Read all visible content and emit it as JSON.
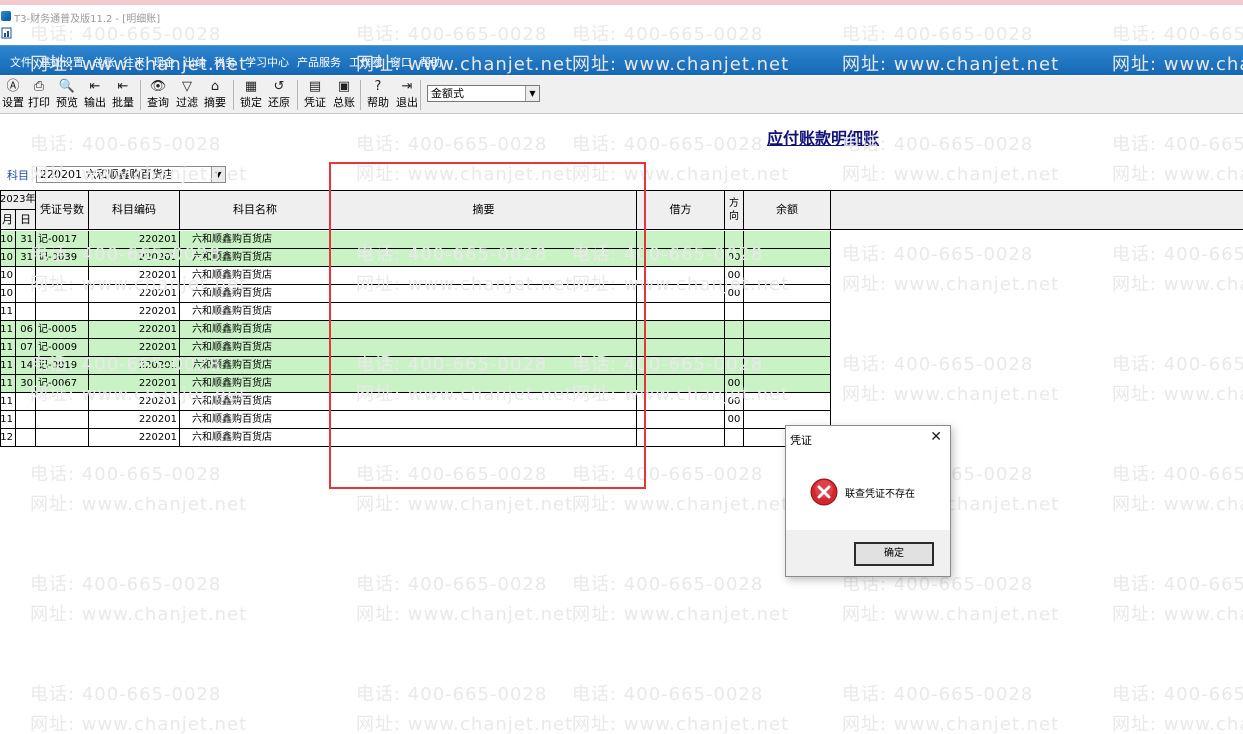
{
  "window": {
    "title": "T3-财务通普及版11.2 - [明细账]",
    "app_icon": "app-logo-icon",
    "doc_icon": "document-icon"
  },
  "menu": [
    "文件",
    "基础设置",
    "总账",
    "往来",
    "现金",
    "出纳",
    "税务",
    "学习中心",
    "产品服务",
    "工作圈",
    "窗口",
    "帮助"
  ],
  "toolbar": {
    "buttons": [
      {
        "label": "设置",
        "icon": "settings-icon"
      },
      {
        "label": "打印",
        "icon": "printer-icon"
      },
      {
        "label": "预览",
        "icon": "preview-icon"
      },
      {
        "label": "输出",
        "icon": "export-icon"
      },
      {
        "label": "批量",
        "icon": "batch-icon"
      },
      {
        "label": "查询",
        "icon": "binoculars-icon"
      },
      {
        "label": "过滤",
        "icon": "filter-icon"
      },
      {
        "label": "摘要",
        "icon": "summary-icon"
      },
      {
        "label": "锁定",
        "icon": "lock-icon"
      },
      {
        "label": "还原",
        "icon": "restore-icon"
      },
      {
        "label": "凭证",
        "icon": "voucher-icon"
      },
      {
        "label": "总账",
        "icon": "ledger-icon"
      },
      {
        "label": "帮助",
        "icon": "help-icon"
      },
      {
        "label": "退出",
        "icon": "exit-icon"
      }
    ],
    "format_select": "金额式"
  },
  "report": {
    "title": "应付账款明细账",
    "subject_label": "科目",
    "subject_value": "220201 六和顺鑫购百货店"
  },
  "table": {
    "year_header": "2023年",
    "headers": {
      "month": "月",
      "day": "日",
      "voucher_no": "凭证号数",
      "account_code": "科目编码",
      "account_name": "科目名称",
      "summary": "摘要",
      "debit": "借方",
      "direction": "方向",
      "balance": "余额"
    },
    "rows": [
      {
        "month": "10",
        "day": "31",
        "voucher": "记-0017",
        "code": "220201",
        "name": "六和顺鑫购百货店",
        "summary": "",
        "debit": "",
        "dir": "",
        "balance": "",
        "green": true
      },
      {
        "month": "10",
        "day": "31",
        "voucher": "记-0039",
        "code": "220201",
        "name": "六和顺鑫购百货店",
        "summary": "",
        "debit": "",
        "dir": "00",
        "balance": "",
        "green": true
      },
      {
        "month": "10",
        "day": "",
        "voucher": "",
        "code": "220201",
        "name": "六和顺鑫购百货店",
        "summary": "",
        "debit": "",
        "dir": "00",
        "balance": "",
        "green": false
      },
      {
        "month": "10",
        "day": "",
        "voucher": "",
        "code": "220201",
        "name": "六和顺鑫购百货店",
        "summary": "",
        "debit": "",
        "dir": "00",
        "balance": "",
        "green": false
      },
      {
        "month": "11",
        "day": "",
        "voucher": "",
        "code": "220201",
        "name": "六和顺鑫购百货店",
        "summary": "",
        "debit": "",
        "dir": "",
        "balance": "",
        "green": false
      },
      {
        "month": "11",
        "day": "06",
        "voucher": "记-0005",
        "code": "220201",
        "name": "六和顺鑫购百货店",
        "summary": "",
        "debit": "",
        "dir": "",
        "balance": "",
        "green": true
      },
      {
        "month": "11",
        "day": "07",
        "voucher": "记-0009",
        "code": "220201",
        "name": "六和顺鑫购百货店",
        "summary": "",
        "debit": "",
        "dir": "",
        "balance": "",
        "green": true
      },
      {
        "month": "11",
        "day": "14",
        "voucher": "记-0019",
        "code": "220201",
        "name": "六和顺鑫购百货店",
        "summary": "",
        "debit": "",
        "dir": "",
        "balance": "",
        "green": true
      },
      {
        "month": "11",
        "day": "30",
        "voucher": "记-0067",
        "code": "220201",
        "name": "六和顺鑫购百货店",
        "summary": "",
        "debit": "",
        "dir": "00",
        "balance": "",
        "green": true
      },
      {
        "month": "11",
        "day": "",
        "voucher": "",
        "code": "220201",
        "name": "六和顺鑫购百货店",
        "summary": "",
        "debit": "",
        "dir": "00",
        "balance": "",
        "green": false
      },
      {
        "month": "11",
        "day": "",
        "voucher": "",
        "code": "220201",
        "name": "六和顺鑫购百货店",
        "summary": "",
        "debit": "",
        "dir": "00",
        "balance": "",
        "green": false
      },
      {
        "month": "12",
        "day": "",
        "voucher": "",
        "code": "220201",
        "name": "六和顺鑫购百货店",
        "summary": "",
        "debit": "",
        "dir": "",
        "balance": "",
        "green": false
      }
    ]
  },
  "dialog": {
    "title": "凭证",
    "message": "联查凭证不存在",
    "ok_label": "确定",
    "icon": "error-icon",
    "close_icon": "close-icon"
  },
  "watermark": {
    "phone": "电话: 400-665-0028",
    "site": "网址: www.chanjet.net"
  },
  "colors": {
    "menu_bar": "#1f77c4",
    "row_highlight": "#c9f3c5",
    "annotation_red": "#e6363b",
    "title_blue": "#11117a"
  }
}
